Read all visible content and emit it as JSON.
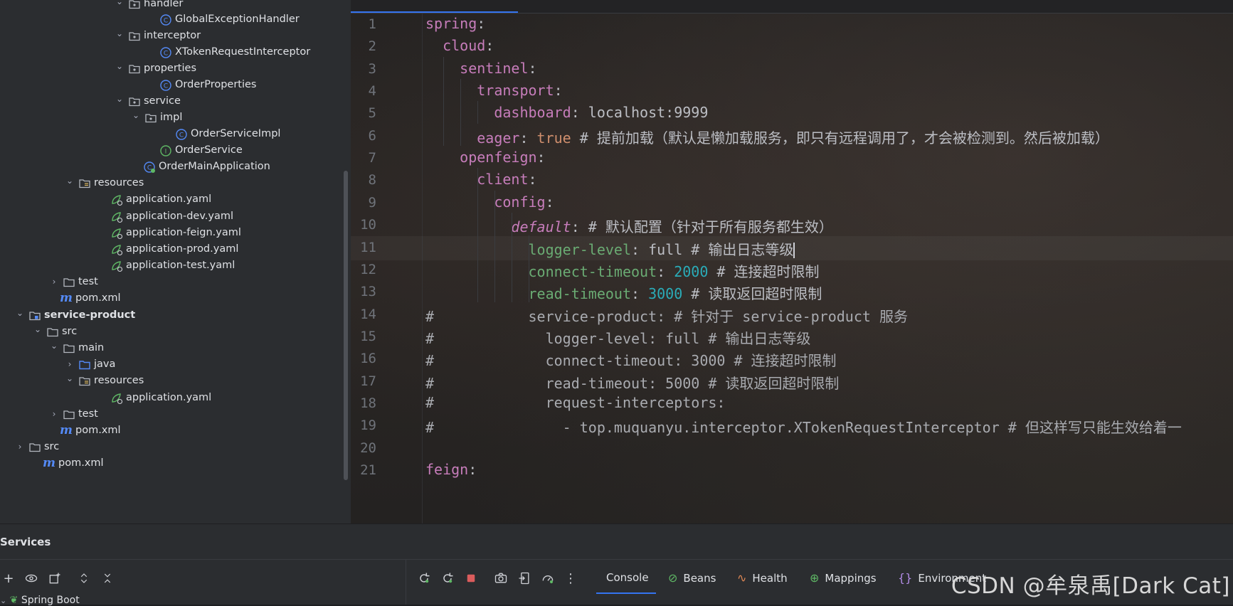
{
  "project_tree": {
    "items": [
      {
        "label": "handler",
        "indent": 180,
        "type": "package",
        "expanded": true
      },
      {
        "label": "GlobalExceptionHandler",
        "indent": 224,
        "type": "class"
      },
      {
        "label": "interceptor",
        "indent": 180,
        "type": "package",
        "expanded": true
      },
      {
        "label": "XTokenRequestInterceptor",
        "indent": 224,
        "type": "class"
      },
      {
        "label": "properties",
        "indent": 180,
        "type": "package",
        "expanded": true
      },
      {
        "label": "OrderProperties",
        "indent": 224,
        "type": "class"
      },
      {
        "label": "service",
        "indent": 180,
        "type": "package",
        "expanded": true
      },
      {
        "label": "impl",
        "indent": 203,
        "type": "package",
        "expanded": true
      },
      {
        "label": "OrderServiceImpl",
        "indent": 246,
        "type": "class"
      },
      {
        "label": "OrderService",
        "indent": 224,
        "type": "interface"
      },
      {
        "label": "OrderMainApplication",
        "indent": 201,
        "type": "spring-class"
      },
      {
        "label": "resources",
        "indent": 110,
        "type": "resources",
        "expanded": true
      },
      {
        "label": "application.yaml",
        "indent": 155,
        "type": "yaml"
      },
      {
        "label": "application-dev.yaml",
        "indent": 155,
        "type": "yaml"
      },
      {
        "label": "application-feign.yaml",
        "indent": 155,
        "type": "yaml"
      },
      {
        "label": "application-prod.yaml",
        "indent": 155,
        "type": "yaml"
      },
      {
        "label": "application-test.yaml",
        "indent": 155,
        "type": "yaml"
      },
      {
        "label": "test",
        "indent": 88,
        "type": "folder",
        "expanded": false
      },
      {
        "label": "pom.xml",
        "indent": 84,
        "type": "pom"
      },
      {
        "label": "service-product",
        "indent": 40,
        "type": "module",
        "expanded": true,
        "bold": true
      },
      {
        "label": "src",
        "indent": 65,
        "type": "folder",
        "expanded": true
      },
      {
        "label": "main",
        "indent": 88,
        "type": "folder",
        "expanded": true
      },
      {
        "label": "java",
        "indent": 110,
        "type": "source",
        "expanded": false
      },
      {
        "label": "resources",
        "indent": 110,
        "type": "resources",
        "expanded": true
      },
      {
        "label": "application.yaml",
        "indent": 155,
        "type": "yaml"
      },
      {
        "label": "test",
        "indent": 88,
        "type": "folder",
        "expanded": false
      },
      {
        "label": "pom.xml",
        "indent": 84,
        "type": "pom"
      },
      {
        "label": "src",
        "indent": 40,
        "type": "folder",
        "expanded": false
      },
      {
        "label": "pom.xml",
        "indent": 60,
        "type": "pom"
      }
    ]
  },
  "editor": {
    "current_line": 11,
    "lines": [
      {
        "n": "1",
        "tokens": [
          {
            "t": "spring",
            "c": "k"
          },
          {
            "t": ":",
            "c": "str"
          }
        ]
      },
      {
        "n": "2",
        "tokens": [
          {
            "t": "  cloud",
            "c": "k"
          },
          {
            "t": ":",
            "c": "str"
          }
        ]
      },
      {
        "n": "3",
        "tokens": [
          {
            "t": "    sentinel",
            "c": "k"
          },
          {
            "t": ":",
            "c": "str"
          }
        ]
      },
      {
        "n": "4",
        "tokens": [
          {
            "t": "      transport",
            "c": "k"
          },
          {
            "t": ":",
            "c": "str"
          }
        ]
      },
      {
        "n": "5",
        "tokens": [
          {
            "t": "        dashboard",
            "c": "k"
          },
          {
            "t": ": localhost:9999",
            "c": "str"
          }
        ]
      },
      {
        "n": "6",
        "tokens": [
          {
            "t": "      eager",
            "c": "k"
          },
          {
            "t": ": ",
            "c": "str"
          },
          {
            "t": "true",
            "c": "bool"
          },
          {
            "t": " # 提前加载（默认是懒加载服务，即只有远程调用了，才会被检测到。然后被加载）",
            "c": "cm"
          }
        ]
      },
      {
        "n": "7",
        "tokens": [
          {
            "t": "    openfeign",
            "c": "k"
          },
          {
            "t": ":",
            "c": "str"
          }
        ]
      },
      {
        "n": "8",
        "tokens": [
          {
            "t": "      client",
            "c": "k"
          },
          {
            "t": ":",
            "c": "str"
          }
        ]
      },
      {
        "n": "9",
        "tokens": [
          {
            "t": "        config",
            "c": "k"
          },
          {
            "t": ":",
            "c": "str"
          }
        ]
      },
      {
        "n": "10",
        "tokens": [
          {
            "t": "          default",
            "c": "kd"
          },
          {
            "t": ": # 默认配置（针对于所有服务都生效）",
            "c": "cm"
          }
        ]
      },
      {
        "n": "11",
        "tokens": [
          {
            "t": "            logger-level",
            "c": "k2"
          },
          {
            "t": ": full # 输出日志等级",
            "c": "cm"
          }
        ]
      },
      {
        "n": "12",
        "tokens": [
          {
            "t": "            connect-timeout",
            "c": "k2"
          },
          {
            "t": ": ",
            "c": "str"
          },
          {
            "t": "2000",
            "c": "num"
          },
          {
            "t": " # 连接超时限制",
            "c": "cm"
          }
        ]
      },
      {
        "n": "13",
        "tokens": [
          {
            "t": "            read-timeout",
            "c": "k2"
          },
          {
            "t": ": ",
            "c": "str"
          },
          {
            "t": "3000",
            "c": "num"
          },
          {
            "t": " # 读取返回超时限制",
            "c": "cm"
          }
        ]
      },
      {
        "n": "14",
        "tokens": [
          {
            "t": "#           service-product: # 针对于 service-product 服务",
            "c": "ccm"
          }
        ]
      },
      {
        "n": "15",
        "tokens": [
          {
            "t": "#             logger-level: full # 输出日志等级",
            "c": "ccm"
          }
        ]
      },
      {
        "n": "16",
        "tokens": [
          {
            "t": "#             connect-timeout: 3000 # 连接超时限制",
            "c": "ccm"
          }
        ]
      },
      {
        "n": "17",
        "tokens": [
          {
            "t": "#             read-timeout: 5000 # 读取返回超时限制",
            "c": "ccm"
          }
        ]
      },
      {
        "n": "18",
        "tokens": [
          {
            "t": "#             request-interceptors:",
            "c": "ccm"
          }
        ]
      },
      {
        "n": "19",
        "tokens": [
          {
            "t": "#               - top.muquanyu.interceptor.XTokenRequestInterceptor # 但这样写只能生效给着一",
            "c": "ccm"
          }
        ]
      },
      {
        "n": "20",
        "tokens": [
          {
            "t": "",
            "c": "str"
          }
        ]
      },
      {
        "n": "21",
        "tokens": [
          {
            "t": "feign",
            "c": "k"
          },
          {
            "t": ":",
            "c": "str"
          }
        ]
      }
    ]
  },
  "services": {
    "title": "Services",
    "tabs": [
      {
        "label": "Console",
        "icon": ""
      },
      {
        "label": "Beans",
        "icon": "⊘"
      },
      {
        "label": "Health",
        "icon": "∿"
      },
      {
        "label": "Mappings",
        "icon": "⊕"
      },
      {
        "label": "Environment",
        "icon": "{}"
      }
    ],
    "tree_item": "Spring Boot"
  },
  "watermark": "CSDN @牟泉禹[Dark Cat]",
  "colors": {
    "accent": "#3574f0",
    "keyword": "#c77dbb",
    "green_key": "#6aab73",
    "number": "#2aacb8",
    "bool": "#cf8e6d"
  }
}
